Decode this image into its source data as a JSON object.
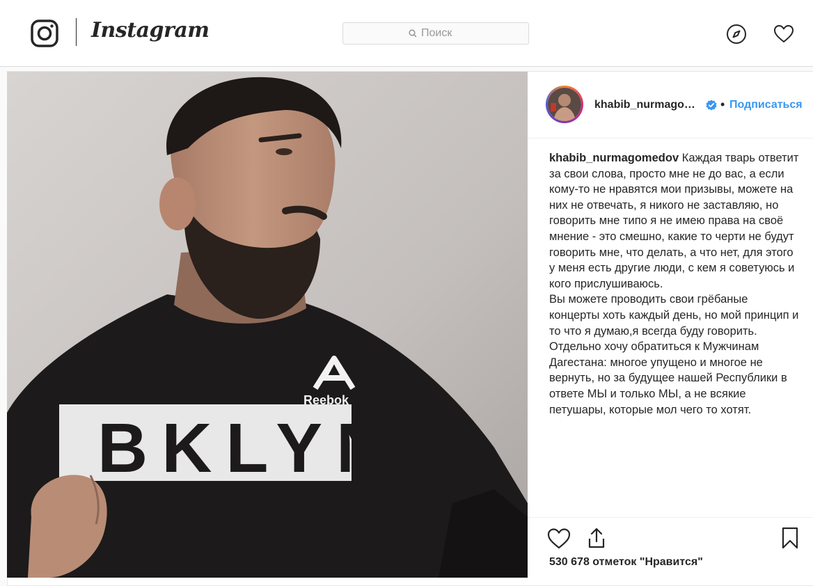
{
  "header": {
    "app_name": "Instagram",
    "search": {
      "placeholder": "Поиск"
    }
  },
  "post": {
    "author": {
      "username_display": "khabib_nurmago…",
      "username": "khabib_nurmagomedov",
      "verified": true,
      "follow_label": "Подписаться",
      "separator": "•"
    },
    "caption": {
      "lines": [
        "Каждая тварь ответит за свои слова, просто мне не до вас, а если кому-то не нравятся мои призывы, можете на них не отвечать, я никого не заставляю, но говорить мне типо я не имею права на своё мнение - это смешно, какие то черти не будут говорить мне, что делать, а что нет, для этого у меня есть другие люди, с кем я советуюсь и кого прислушиваюсь.",
        "Вы можете проводить свои грёбаные концерты хоть каждый день, но мой принцип и то что я думаю,я всегда буду говорить.",
        "Отдельно хочу обратиться к Мужчинам Дагестана: многое упущено и многое не вернуть, но за будущее нашей Республики в ответе МЫ и только МЫ, а не всякие петушары, которые мол чего то хотят."
      ]
    },
    "photo": {
      "shirt_brand": "Reebok",
      "shirt_print": "BKLYN"
    },
    "likes_text": "530 678 отметок \"Нравится\""
  },
  "colors": {
    "accent": "#3897f0",
    "text": "#262626",
    "border": "#dbdbdb",
    "background": "#fafafa"
  },
  "icons": {
    "brand": "instagram-icon",
    "explore": "compass-icon",
    "activity": "heart-icon",
    "like": "heart-icon",
    "share": "share-icon",
    "save": "bookmark-icon",
    "verified": "verified-badge-icon",
    "search": "search-icon"
  }
}
